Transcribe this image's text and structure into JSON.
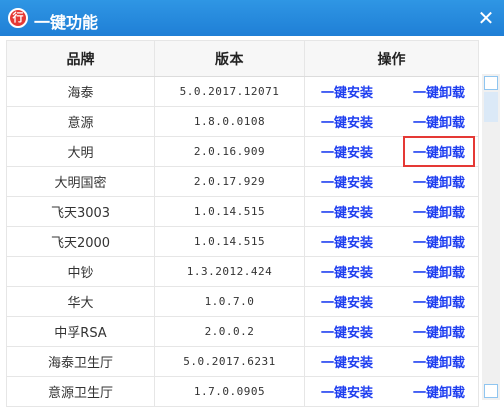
{
  "window": {
    "title": "一键功能",
    "close_glyph": "✕",
    "icon_text": "行"
  },
  "table": {
    "headers": [
      "品牌",
      "版本",
      "操作"
    ],
    "rows": [
      {
        "brand": "海泰",
        "version": "5.0.2017.12071",
        "install": "一键安装",
        "uninstall": "一键卸载"
      },
      {
        "brand": "意源",
        "version": "1.8.0.0108",
        "install": "一键安装",
        "uninstall": "一键卸载"
      },
      {
        "brand": "大明",
        "version": "2.0.16.909",
        "install": "一键安装",
        "uninstall": "一键卸载"
      },
      {
        "brand": "大明国密",
        "version": "2.0.17.929",
        "install": "一键安装",
        "uninstall": "一键卸载"
      },
      {
        "brand": "飞天3003",
        "version": "1.0.14.515",
        "install": "一键安装",
        "uninstall": "一键卸载"
      },
      {
        "brand": "飞天2000",
        "version": "1.0.14.515",
        "install": "一键安装",
        "uninstall": "一键卸载"
      },
      {
        "brand": "中钞",
        "version": "1.3.2012.424",
        "install": "一键安装",
        "uninstall": "一键卸载"
      },
      {
        "brand": "华大",
        "version": "1.0.7.0",
        "install": "一键安装",
        "uninstall": "一键卸载"
      },
      {
        "brand": "中孚RSA",
        "version": "2.0.0.2",
        "install": "一键安装",
        "uninstall": "一键卸载"
      },
      {
        "brand": "海泰卫生厅",
        "version": "5.0.2017.6231",
        "install": "一键安装",
        "uninstall": "一键卸载"
      },
      {
        "brand": "意源卫生厅",
        "version": "1.7.0.0905",
        "install": "一键安装",
        "uninstall": "一键卸载"
      }
    ]
  },
  "colors": {
    "titlebar": "#1f7fd6",
    "link": "#1d3df0",
    "highlight": "#e53935"
  }
}
